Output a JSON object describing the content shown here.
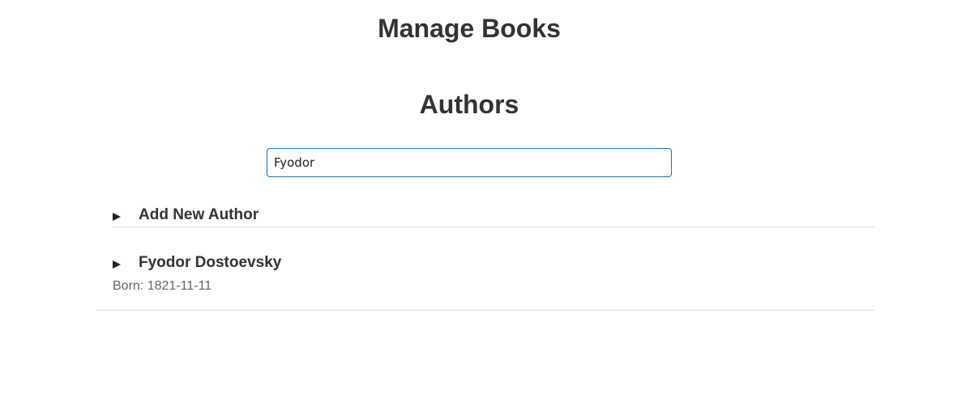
{
  "header": {
    "title": "Manage Books"
  },
  "authors_section": {
    "title": "Authors",
    "search": {
      "value": "Fyodor"
    },
    "add_new": {
      "label": "Add New Author"
    },
    "authors": [
      {
        "name": "Fyodor Dostoevsky",
        "born_label": "Born:",
        "born_date": "1821-11-11"
      }
    ]
  }
}
